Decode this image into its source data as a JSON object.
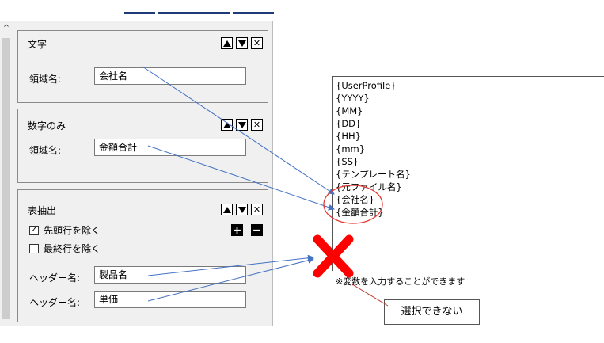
{
  "panels": [
    {
      "title": "文字",
      "field_label": "領域名:",
      "field_value": "会社名"
    },
    {
      "title": "数字のみ",
      "field_label": "領域名:",
      "field_value": "金額合計"
    },
    {
      "title": "表抽出",
      "checkboxes": [
        {
          "label": "先頭行を除く",
          "checked": true
        },
        {
          "label": "最終行を除く",
          "checked": false
        }
      ],
      "headers": [
        {
          "label": "ヘッダー名:",
          "value": "製品名"
        },
        {
          "label": "ヘッダー名:",
          "value": "単価"
        }
      ],
      "add_label": "+",
      "remove_label": "−"
    }
  ],
  "panel_controls": {
    "up_icon": "triangle-up-icon",
    "down_icon": "triangle-down-icon",
    "close_label": "✕",
    "check_mark": "✓"
  },
  "scroll": {
    "up_label": "^"
  },
  "variables": [
    "{UserProfile}",
    "{YYYY}",
    "{MM}",
    "{DD}",
    "{HH}",
    "{mm}",
    "{SS}",
    "{テンプレート名}",
    "{元ファイル名}",
    "{会社名}",
    "{金額合計}"
  ],
  "note": "※変数を入力することができます",
  "callout": "選択できない",
  "colors": {
    "arrow": "#4472c4",
    "highlight": "#e53935",
    "cross": "#ff0000",
    "panel_bg": "#f0f0f0",
    "top_line": "#1f3a78"
  }
}
